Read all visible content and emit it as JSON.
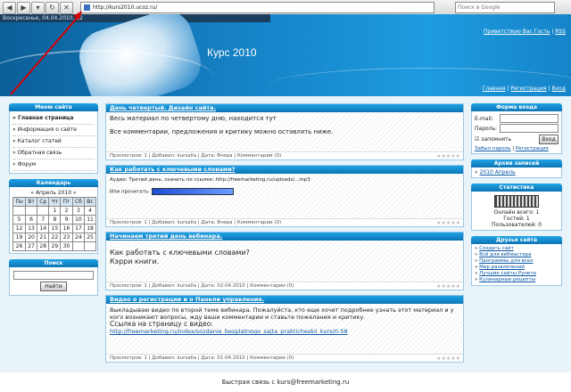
{
  "browser": {
    "address": "http://kurs2010.ucoz.ru/",
    "search_placeholder": "Поиск в Google"
  },
  "header": {
    "date_line": "Воскресенье, 04.04.2010, 22",
    "site_title": "Курс 2010",
    "greeting": "Приветствую Вас Гость",
    "rss": "RSS",
    "links": [
      "Главная",
      "Регистрация",
      "Вход"
    ]
  },
  "left": {
    "menu_title": "Меню сайта",
    "menu": [
      "Главная страница",
      "Информация о сайте",
      "Каталог статей",
      "Обратная связь",
      "Форум"
    ],
    "calendar_title": "Календарь",
    "calendar_month": "« Апрель 2010 »",
    "weekdays": [
      "Пн",
      "Вт",
      "Ср",
      "Чт",
      "Пт",
      "Сб",
      "Вс"
    ],
    "weeks": [
      [
        "",
        "",
        "",
        "1",
        "2",
        "3",
        "4"
      ],
      [
        "5",
        "6",
        "7",
        "8",
        "9",
        "10",
        "11"
      ],
      [
        "12",
        "13",
        "14",
        "15",
        "16",
        "17",
        "18"
      ],
      [
        "19",
        "20",
        "21",
        "22",
        "23",
        "24",
        "25"
      ],
      [
        "26",
        "27",
        "28",
        "29",
        "30",
        "",
        ""
      ]
    ],
    "search_title": "Поиск",
    "search_button": "Найти"
  },
  "posts": [
    {
      "title": "День четвертый. Дизайн сайта.",
      "body1": "Весь материал по четвертому дню, находится тут",
      "body2": "Все комментарии, предложения и критику можно оставлять ниже.",
      "meta": "Просмотров: 1 | Добавил: kursalla | Дата: Вчера | Комментарии (0)"
    },
    {
      "title": "Как работать с ключевыми словами?",
      "body1": "Аудио: Третий день, скачать по ссылке: http://freemarketing.ru/uploads/...mp3",
      "body2": "Или прочитать:",
      "meta": "Просмотров: 1 | Добавил: kursalla | Дата: Вчера | Комментарии (0)"
    },
    {
      "title": "Начинаем третий день вебинара.",
      "body1": "Как работать с ключевыми словами?",
      "body2": "Кэрри книги.",
      "meta": "Просмотров: 1 | Добавил: kursalla | Дата: 02.04.2010 | Комментарии (0)"
    },
    {
      "title": "Видео о регистрации и о Панели управления.",
      "body1": "Выкладываю видео по второй теме вебинара. Пожалуйста, кто еще хочет подробнее узнать этот материал и у кого возникают вопросы, жду ваши комментарии и ставьте пожелания и критику.",
      "body2": "Ссылка на страницу с видео:",
      "body3": "http://freemarketing.ru/index/sozdanie_besplatnogo_sajta_prakticheskii_kurs/0-58",
      "meta": "Просмотров: 1 | Добавил: kursalla | Дата: 01.04.2010 | Комментарии (0)"
    }
  ],
  "right": {
    "login_title": "Форма входа",
    "email_label": "E-mail:",
    "password_label": "Пароль:",
    "remember": "запомнить",
    "login_button": "Вход",
    "forgot": "Забыл пароль",
    "register": "Регистрация",
    "archive_title": "Архив записей",
    "archive_item": "2010 Апрель",
    "stats_title": "Статистика",
    "online": [
      "Онлайн всего: 1",
      "Гостей: 1",
      "Пользователей: 0"
    ],
    "friends_title": "Друзья сайта",
    "friends": [
      "Создать сайт",
      "Всё для вебмастера",
      "Программы для всех",
      "Мир развлечений",
      "Лучшие сайты Рунета",
      "Кулинарные рецепты"
    ]
  },
  "footer": {
    "text": "Быстрая связь с kurs@freemarketing.ru"
  }
}
